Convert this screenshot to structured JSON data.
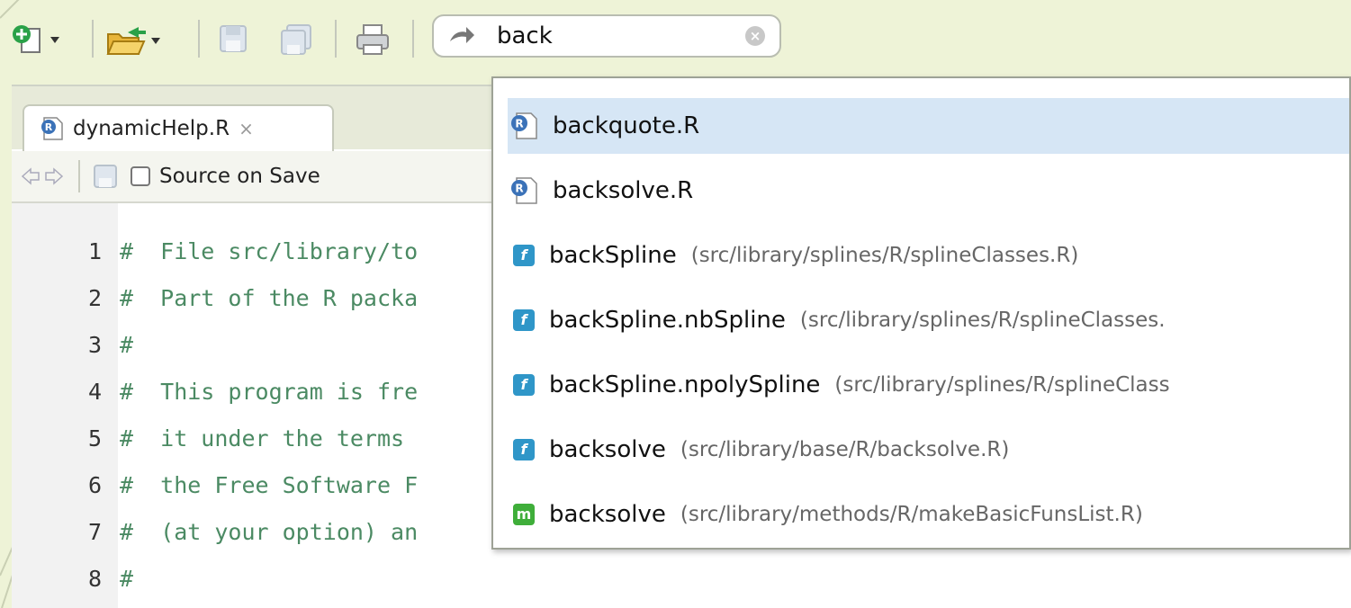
{
  "toolbar": {
    "new_file_icon": "new-file-icon",
    "open_icon": "open-folder-icon",
    "save_icon": "save-icon",
    "save_all_icon": "save-all-icon",
    "print_icon": "print-icon",
    "goto_value": "back"
  },
  "editor": {
    "tab_label": "dynamicHelp.R",
    "tab_close": "×",
    "source_on_save": "Source on Save",
    "lines": [
      {
        "num": "1",
        "text": "#  File src/library/to"
      },
      {
        "num": "2",
        "text": "#  Part of the R packa"
      },
      {
        "num": "3",
        "text": "#"
      },
      {
        "num": "4",
        "text": "#  This program is fre"
      },
      {
        "num": "5",
        "text": "#  it under the terms "
      },
      {
        "num": "6",
        "text": "#  the Free Software F"
      },
      {
        "num": "7",
        "text": "#  (at your option) an"
      },
      {
        "num": "8",
        "text": "#"
      }
    ]
  },
  "popup": {
    "items": [
      {
        "icon": "r-file",
        "name": "backquote.R",
        "path": "",
        "selected": true
      },
      {
        "icon": "r-file",
        "name": "backsolve.R",
        "path": ""
      },
      {
        "icon": "f",
        "name": "backSpline",
        "path": "(src/library/splines/R/splineClasses.R)"
      },
      {
        "icon": "f",
        "name": "backSpline.nbSpline",
        "path": "(src/library/splines/R/splineClasses."
      },
      {
        "icon": "f",
        "name": "backSpline.npolySpline",
        "path": "(src/library/splines/R/splineClass"
      },
      {
        "icon": "f",
        "name": "backsolve",
        "path": "(src/library/base/R/backsolve.R)"
      },
      {
        "icon": "m",
        "name": "backsolve",
        "path": "(src/library/methods/R/makeBasicFunsList.R)"
      }
    ]
  },
  "colors": {
    "background": "#eef3d7",
    "selection": "#d6e6f5",
    "comment": "#4b8a63",
    "function_icon": "#2f96c8",
    "method_icon": "#3fae3a"
  }
}
